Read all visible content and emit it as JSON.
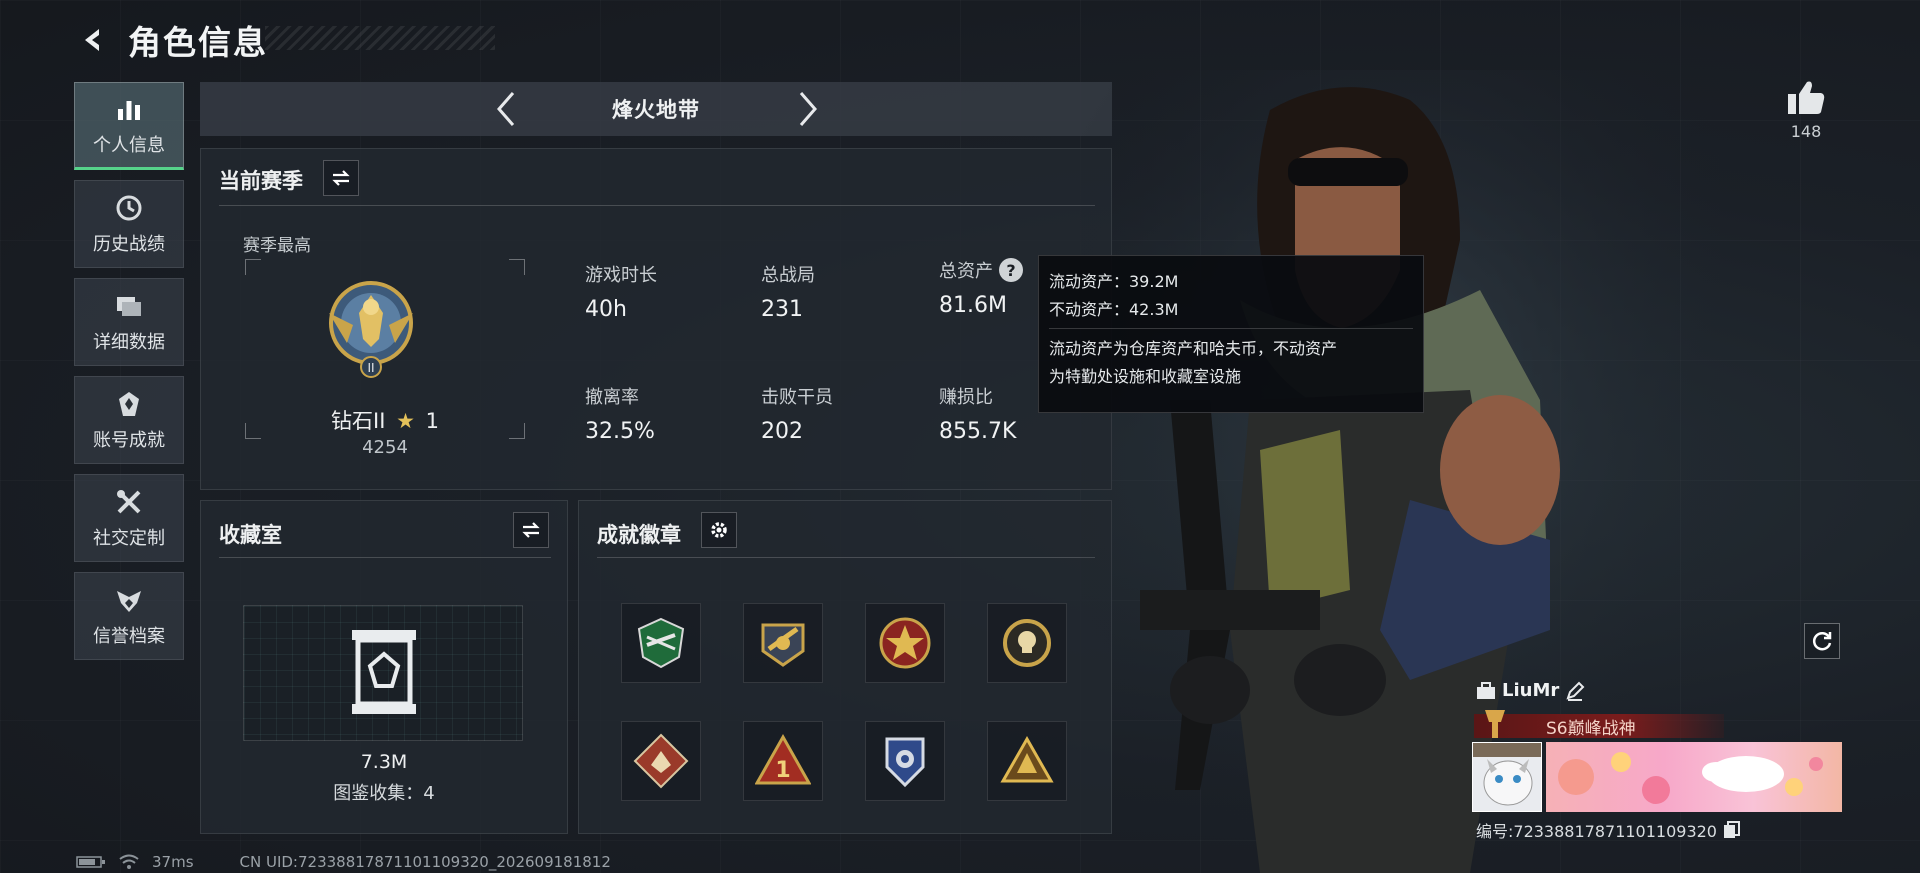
{
  "header": {
    "title": "角色信息"
  },
  "nav": [
    {
      "label": "个人信息",
      "icon": "bar-chart-icon",
      "active": true
    },
    {
      "label": "历史战绩",
      "icon": "history-clock-icon"
    },
    {
      "label": "详细数据",
      "icon": "folder-stack-icon"
    },
    {
      "label": "账号成就",
      "icon": "medal-icon"
    },
    {
      "label": "社交定制",
      "icon": "wrench-screwdriver-icon"
    },
    {
      "label": "信誉档案",
      "icon": "shield-wings-icon"
    }
  ],
  "mode": {
    "name": "烽火地带"
  },
  "season": {
    "title": "当前赛季",
    "best_label": "赛季最高",
    "rank_name": "钻石II",
    "rank_stars": "1",
    "rank_score": "4254",
    "stats": [
      {
        "label": "游戏时长",
        "value": "40h"
      },
      {
        "label": "总战局",
        "value": "231"
      },
      {
        "label": "总资产",
        "value": "81.6M",
        "has_help": true
      },
      {
        "label": "撤离率",
        "value": "32.5%"
      },
      {
        "label": "击败干员",
        "value": "202"
      },
      {
        "label": "赚损比",
        "value": "855.7K"
      }
    ]
  },
  "tooltip": {
    "liquid": "流动资产：39.2M",
    "fixed": "不动资产：42.3M",
    "desc_line1": "流动资产为仓库资产和哈夫币，不动资产",
    "desc_line2": "为特勤处设施和收藏室设施"
  },
  "collection": {
    "title": "收藏室",
    "value": "7.3M",
    "count_text": "图鉴收集：4"
  },
  "achievements": {
    "title": "成就徽章",
    "badges": [
      "green-rifle-badge",
      "gold-cannon-badge",
      "star-emblem-badge",
      "skull-ring-badge",
      "beast-diamond-badge",
      "number-one-triangle-badge",
      "police-shield-badge",
      "gold-triangle-badge"
    ]
  },
  "likes": {
    "count": "148"
  },
  "player": {
    "name": "LiuMr",
    "title": "S6巅峰战神",
    "uid_text": "编号:72338817871101109320"
  },
  "status": {
    "ping": "37ms",
    "uid": "CN UID:72338817871101109320_202609181812"
  },
  "colors": {
    "accent_green": "#56d38a",
    "title_red": "#7a1c1c",
    "gold": "#c9a44a"
  }
}
